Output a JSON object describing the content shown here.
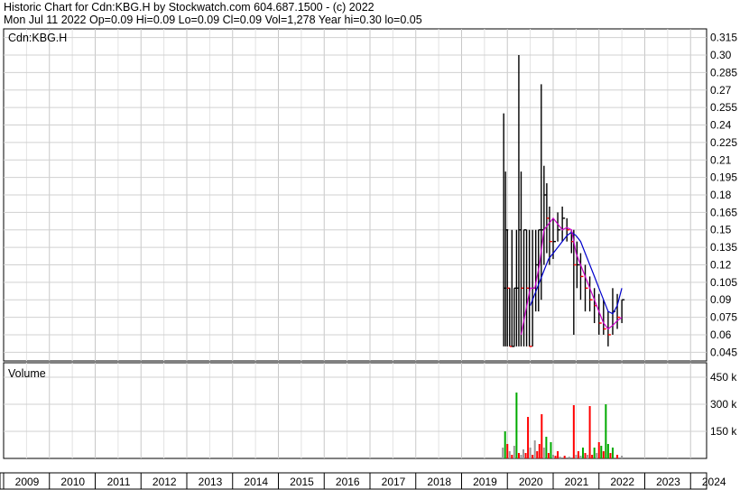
{
  "header": {
    "title": "Historic Chart for Cdn:KBG.H by Stockwatch.com 604.687.1500 - (c) 2022",
    "summary": "Mon Jul 11 2022  Op=0.09  Hi=0.09  Lo=0.09  Cl=0.09  Vol=1,278  Year hi=0.30  lo=0.05"
  },
  "chart_data": {
    "type": "line",
    "title": "Cdn:KBG.H",
    "grid": true,
    "x_axis": {
      "labels": [
        "2009",
        "2010",
        "2011",
        "2012",
        "2013",
        "2014",
        "2015",
        "2016",
        "2017",
        "2018",
        "2019",
        "2020",
        "2021",
        "2022",
        "2023",
        "2024"
      ],
      "range": [
        2009,
        2024.35
      ]
    },
    "price_axis": {
      "range": [
        0.0375,
        0.3225
      ],
      "ticks": [
        0.315,
        0.3,
        0.285,
        0.27,
        0.255,
        0.24,
        0.225,
        0.21,
        0.195,
        0.18,
        0.165,
        0.15,
        0.135,
        0.12,
        0.105,
        0.09,
        0.075,
        0.06,
        0.045
      ],
      "tick_labels": [
        "0.315",
        "0.30",
        "0.285",
        "0.27",
        "0.255",
        "0.24",
        "0.225",
        "0.21",
        "0.195",
        "0.18",
        "0.165",
        "0.15",
        "0.135",
        "0.12",
        "0.105",
        "0.09",
        "0.075",
        "0.06",
        "0.045"
      ],
      "position": "right"
    },
    "volume_panel": {
      "label": "Volume",
      "tick_labels": [
        "450 k",
        "300 k",
        "150 k"
      ],
      "ticks": [
        450000,
        300000,
        150000
      ],
      "range": [
        0,
        530000
      ]
    },
    "price_bars": [
      {
        "t": 2019.92,
        "h": 0.25,
        "l": 0.05,
        "c": 0.1
      },
      {
        "t": 2019.96,
        "h": 0.2,
        "l": 0.05,
        "c": 0.15
      },
      {
        "t": 2020.0,
        "h": 0.15,
        "l": 0.05,
        "c": 0.1
      },
      {
        "t": 2020.05,
        "h": 0.1,
        "l": 0.05,
        "c": 0.05
      },
      {
        "t": 2020.1,
        "h": 0.15,
        "l": 0.05,
        "c": 0.05
      },
      {
        "t": 2020.15,
        "h": 0.1,
        "l": 0.05,
        "c": 0.1
      },
      {
        "t": 2020.2,
        "h": 0.15,
        "l": 0.05,
        "c": 0.1
      },
      {
        "t": 2020.25,
        "h": 0.3,
        "l": 0.05,
        "c": 0.15
      },
      {
        "t": 2020.3,
        "h": 0.2,
        "l": 0.05,
        "c": 0.1
      },
      {
        "t": 2020.36,
        "h": 0.15,
        "l": 0.05,
        "c": 0.15
      },
      {
        "t": 2020.42,
        "h": 0.15,
        "l": 0.05,
        "c": 0.1
      },
      {
        "t": 2020.48,
        "h": 0.15,
        "l": 0.05,
        "c": 0.05
      },
      {
        "t": 2020.55,
        "h": 0.15,
        "l": 0.05,
        "c": 0.1
      },
      {
        "t": 2020.62,
        "h": 0.15,
        "l": 0.08,
        "c": 0.12
      },
      {
        "t": 2020.68,
        "h": 0.15,
        "l": 0.08,
        "c": 0.15
      },
      {
        "t": 2020.74,
        "h": 0.275,
        "l": 0.09,
        "c": 0.15
      },
      {
        "t": 2020.8,
        "h": 0.205,
        "l": 0.12,
        "c": 0.18
      },
      {
        "t": 2020.86,
        "h": 0.19,
        "l": 0.13,
        "c": 0.16
      },
      {
        "t": 2020.92,
        "h": 0.17,
        "l": 0.12,
        "c": 0.14
      },
      {
        "t": 2021.0,
        "h": 0.16,
        "l": 0.125,
        "c": 0.14
      },
      {
        "t": 2021.1,
        "h": 0.165,
        "l": 0.14,
        "c": 0.15
      },
      {
        "t": 2021.2,
        "h": 0.17,
        "l": 0.14,
        "c": 0.16
      },
      {
        "t": 2021.3,
        "h": 0.16,
        "l": 0.14,
        "c": 0.15
      },
      {
        "t": 2021.4,
        "h": 0.15,
        "l": 0.13,
        "c": 0.14
      },
      {
        "t": 2021.45,
        "h": 0.15,
        "l": 0.06,
        "c": 0.12
      },
      {
        "t": 2021.52,
        "h": 0.14,
        "l": 0.1,
        "c": 0.12
      },
      {
        "t": 2021.6,
        "h": 0.13,
        "l": 0.09,
        "c": 0.11
      },
      {
        "t": 2021.7,
        "h": 0.12,
        "l": 0.08,
        "c": 0.1
      },
      {
        "t": 2021.8,
        "h": 0.11,
        "l": 0.08,
        "c": 0.09
      },
      {
        "t": 2021.9,
        "h": 0.1,
        "l": 0.07,
        "c": 0.085
      },
      {
        "t": 2022.0,
        "h": 0.095,
        "l": 0.06,
        "c": 0.07
      },
      {
        "t": 2022.1,
        "h": 0.09,
        "l": 0.06,
        "c": 0.065
      },
      {
        "t": 2022.2,
        "h": 0.08,
        "l": 0.05,
        "c": 0.06
      },
      {
        "t": 2022.3,
        "h": 0.1,
        "l": 0.06,
        "c": 0.08
      },
      {
        "t": 2022.4,
        "h": 0.095,
        "l": 0.065,
        "c": 0.075
      },
      {
        "t": 2022.5,
        "h": 0.09,
        "l": 0.07,
        "c": 0.09
      }
    ],
    "ma_short": {
      "color": "#cc00cc",
      "points": [
        [
          2020.3,
          0.06
        ],
        [
          2020.4,
          0.08
        ],
        [
          2020.5,
          0.1
        ],
        [
          2020.6,
          0.1
        ],
        [
          2020.7,
          0.12
        ],
        [
          2020.8,
          0.15
        ],
        [
          2020.9,
          0.155
        ],
        [
          2021.0,
          0.16
        ],
        [
          2021.1,
          0.155
        ],
        [
          2021.2,
          0.15
        ],
        [
          2021.3,
          0.152
        ],
        [
          2021.4,
          0.15
        ],
        [
          2021.5,
          0.13
        ],
        [
          2021.6,
          0.12
        ],
        [
          2021.7,
          0.11
        ],
        [
          2021.8,
          0.1
        ],
        [
          2021.9,
          0.09
        ],
        [
          2022.0,
          0.08
        ],
        [
          2022.1,
          0.07
        ],
        [
          2022.2,
          0.065
        ],
        [
          2022.3,
          0.068
        ],
        [
          2022.4,
          0.072
        ],
        [
          2022.5,
          0.075
        ]
      ]
    },
    "ma_long": {
      "color": "#0000cc",
      "points": [
        [
          2020.5,
          0.085
        ],
        [
          2020.6,
          0.095
        ],
        [
          2020.7,
          0.105
        ],
        [
          2020.8,
          0.115
        ],
        [
          2020.9,
          0.125
        ],
        [
          2021.0,
          0.13
        ],
        [
          2021.1,
          0.135
        ],
        [
          2021.2,
          0.14
        ],
        [
          2021.3,
          0.145
        ],
        [
          2021.4,
          0.148
        ],
        [
          2021.5,
          0.145
        ],
        [
          2021.6,
          0.14
        ],
        [
          2021.7,
          0.13
        ],
        [
          2021.8,
          0.12
        ],
        [
          2021.9,
          0.11
        ],
        [
          2022.0,
          0.1
        ],
        [
          2022.1,
          0.09
        ],
        [
          2022.2,
          0.08
        ],
        [
          2022.3,
          0.078
        ],
        [
          2022.4,
          0.085
        ],
        [
          2022.5,
          0.1
        ]
      ]
    },
    "volume_bars": [
      {
        "t": 2019.9,
        "v": 60000,
        "color": "#999999"
      },
      {
        "t": 2019.95,
        "v": 150000,
        "color": "#00aa00"
      },
      {
        "t": 2020.0,
        "v": 80000,
        "color": "#ff0000"
      },
      {
        "t": 2020.05,
        "v": 40000,
        "color": "#999999"
      },
      {
        "t": 2020.1,
        "v": 20000,
        "color": "#ff0000"
      },
      {
        "t": 2020.15,
        "v": 70000,
        "color": "#999999"
      },
      {
        "t": 2020.2,
        "v": 365000,
        "color": "#00aa00"
      },
      {
        "t": 2020.25,
        "v": 30000,
        "color": "#ff0000"
      },
      {
        "t": 2020.3,
        "v": 20000,
        "color": "#999999"
      },
      {
        "t": 2020.35,
        "v": 50000,
        "color": "#999999"
      },
      {
        "t": 2020.4,
        "v": 30000,
        "color": "#ff0000"
      },
      {
        "t": 2020.45,
        "v": 230000,
        "color": "#ff0000"
      },
      {
        "t": 2020.5,
        "v": 60000,
        "color": "#999999"
      },
      {
        "t": 2020.55,
        "v": 20000,
        "color": "#ff0000"
      },
      {
        "t": 2020.6,
        "v": 100000,
        "color": "#999999"
      },
      {
        "t": 2020.65,
        "v": 40000,
        "color": "#ff0000"
      },
      {
        "t": 2020.7,
        "v": 80000,
        "color": "#ff0000"
      },
      {
        "t": 2020.75,
        "v": 245000,
        "color": "#ff0000"
      },
      {
        "t": 2020.8,
        "v": 60000,
        "color": "#999999"
      },
      {
        "t": 2020.85,
        "v": 120000,
        "color": "#00aa00"
      },
      {
        "t": 2020.9,
        "v": 30000,
        "color": "#ff0000"
      },
      {
        "t": 2020.95,
        "v": 90000,
        "color": "#00aa00"
      },
      {
        "t": 2021.0,
        "v": 20000,
        "color": "#999999"
      },
      {
        "t": 2021.05,
        "v": 15000,
        "color": "#ff0000"
      },
      {
        "t": 2021.1,
        "v": 40000,
        "color": "#ff0000"
      },
      {
        "t": 2021.15,
        "v": 10000,
        "color": "#999999"
      },
      {
        "t": 2021.25,
        "v": 15000,
        "color": "#ff0000"
      },
      {
        "t": 2021.35,
        "v": 10000,
        "color": "#999999"
      },
      {
        "t": 2021.45,
        "v": 295000,
        "color": "#ff0000"
      },
      {
        "t": 2021.5,
        "v": 20000,
        "color": "#999999"
      },
      {
        "t": 2021.55,
        "v": 40000,
        "color": "#ff0000"
      },
      {
        "t": 2021.6,
        "v": 15000,
        "color": "#999999"
      },
      {
        "t": 2021.65,
        "v": 60000,
        "color": "#00aa00"
      },
      {
        "t": 2021.7,
        "v": 30000,
        "color": "#ff0000"
      },
      {
        "t": 2021.75,
        "v": 20000,
        "color": "#999999"
      },
      {
        "t": 2021.8,
        "v": 290000,
        "color": "#ff0000"
      },
      {
        "t": 2021.85,
        "v": 20000,
        "color": "#ff0000"
      },
      {
        "t": 2021.9,
        "v": 60000,
        "color": "#00aa00"
      },
      {
        "t": 2021.95,
        "v": 30000,
        "color": "#999999"
      },
      {
        "t": 2022.0,
        "v": 90000,
        "color": "#ff0000"
      },
      {
        "t": 2022.05,
        "v": 70000,
        "color": "#00aa00"
      },
      {
        "t": 2022.1,
        "v": 40000,
        "color": "#ff0000"
      },
      {
        "t": 2022.15,
        "v": 300000,
        "color": "#00aa00"
      },
      {
        "t": 2022.2,
        "v": 80000,
        "color": "#00aa00"
      },
      {
        "t": 2022.25,
        "v": 30000,
        "color": "#ff0000"
      },
      {
        "t": 2022.3,
        "v": 60000,
        "color": "#00aa00"
      },
      {
        "t": 2022.4,
        "v": 20000,
        "color": "#ff0000"
      },
      {
        "t": 2022.5,
        "v": 15000,
        "color": "#999999"
      }
    ]
  }
}
